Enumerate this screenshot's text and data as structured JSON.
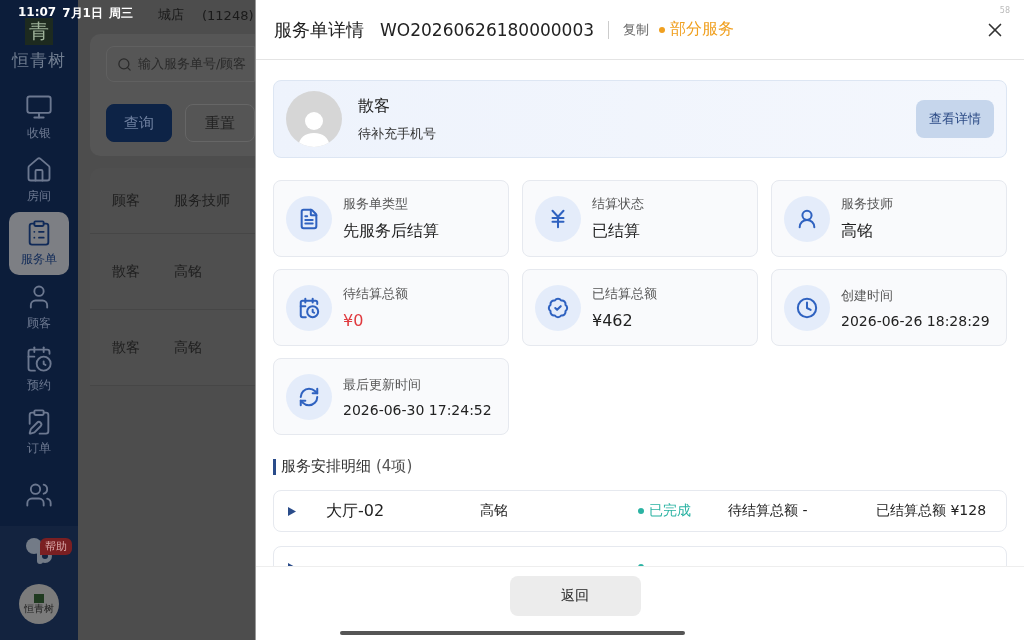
{
  "status_bar": {
    "time": "11:07",
    "date": "7月1日",
    "weekday": "周三",
    "battery": "58"
  },
  "sidebar": {
    "logo_mark": "青",
    "logo_text": "恒青树",
    "items": [
      {
        "kind": "cashier",
        "label": "收银",
        "selected": false
      },
      {
        "kind": "room",
        "label": "房间",
        "selected": false
      },
      {
        "kind": "order",
        "label": "服务单",
        "selected": true
      },
      {
        "kind": "customer",
        "label": "顾客",
        "selected": false
      },
      {
        "kind": "booking",
        "label": "预约",
        "selected": false
      },
      {
        "kind": "list",
        "label": "订单",
        "selected": false
      },
      {
        "kind": "staff",
        "selected": false
      }
    ],
    "help_badge": "帮助",
    "avatar_text": "恒青树"
  },
  "background": {
    "store": "城店",
    "store_code": "(11248)",
    "search": {
      "placeholder": "输入服务单号/顾客"
    },
    "buttons": [
      {
        "label": "查询",
        "primary": true
      },
      {
        "label": "重置",
        "primary": false
      }
    ],
    "columns": [
      "顾客",
      "服务技师"
    ],
    "rows": [
      [
        "散客",
        "高铭"
      ],
      [
        "散客",
        "高铭"
      ]
    ]
  },
  "drawer": {
    "title": "服务单详情",
    "order_no": "WO20260626180000003",
    "copy": "复制",
    "status": {
      "label": "部分服务",
      "color": "#f0a020"
    },
    "customer": {
      "name": "散客",
      "phone": "待补充手机号",
      "button": "查看详情"
    },
    "info": [
      {
        "kind": "doc",
        "label": "服务单类型",
        "value": "先服务后结算",
        "alert": false
      },
      {
        "kind": "yuan",
        "label": "结算状态",
        "value": "已结算",
        "alert": false
      },
      {
        "kind": "tech",
        "label": "服务技师",
        "value": "高铭",
        "alert": false
      },
      {
        "kind": "pending",
        "label": "待结算总额",
        "value": "¥0",
        "alert": true
      },
      {
        "kind": "paid",
        "label": "已结算总额",
        "value": "¥462",
        "alert": false
      },
      {
        "kind": "clock",
        "label": "创建时间",
        "value": "2026-06-26 18:28:29",
        "alert": false
      },
      {
        "kind": "refresh",
        "label": "最后更新时间",
        "value": "2026-06-30 17:24:52",
        "alert": false
      }
    ],
    "section": {
      "title": "服务安排明细",
      "count": "(4项)"
    },
    "services": [
      {
        "room": "大厅-02",
        "tech": "高铭",
        "status": "已完成",
        "color": "#2bb3a3",
        "pending": "待结算总额 -",
        "settled": "已结算总额 ¥128"
      },
      {
        "color": "#2bb3a3"
      }
    ],
    "footer_button": "返回"
  }
}
